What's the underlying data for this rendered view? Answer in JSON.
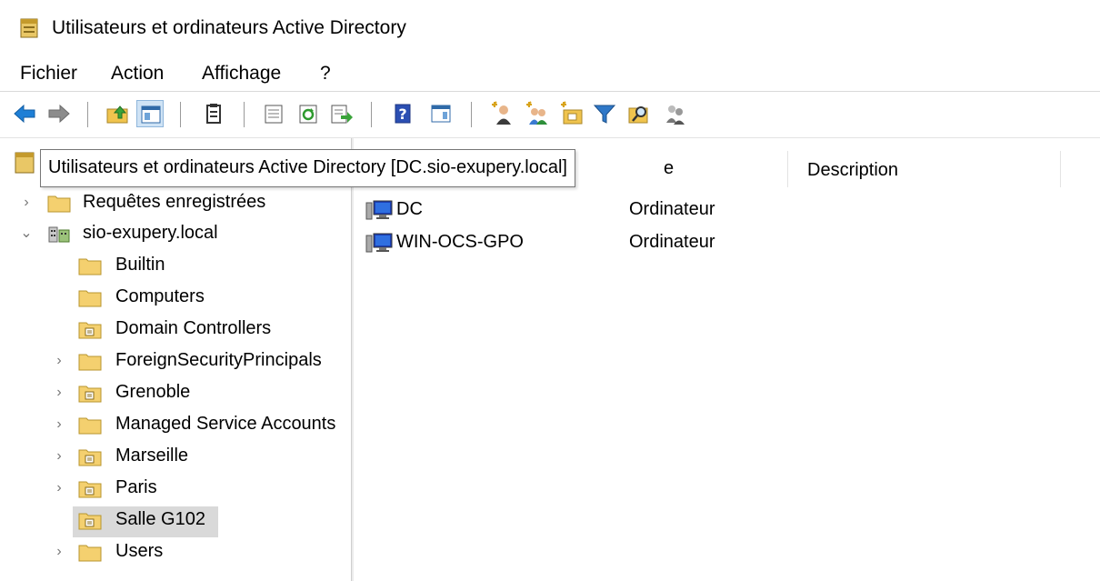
{
  "window": {
    "title": "Utilisateurs et ordinateurs Active Directory",
    "app_icon": "ad-snapin-icon"
  },
  "menubar": {
    "items": [
      {
        "label": "Fichier"
      },
      {
        "label": "Action"
      },
      {
        "label": "Affichage"
      },
      {
        "label": "?"
      }
    ]
  },
  "toolbar": {
    "buttons": [
      "back-arrow-icon",
      "forward-arrow-icon",
      "up-folder-icon",
      "show-hide-console-tree-icon",
      "clipboard-icon",
      "properties-icon",
      "refresh-icon",
      "export-list-icon",
      "help-icon",
      "show-action-pane-icon",
      "new-user-icon",
      "new-group-icon",
      "new-ou-icon",
      "filter-icon",
      "find-icon",
      "add-to-group-icon"
    ]
  },
  "tooltip": {
    "text": "Utilisateurs et ordinateurs Active Directory [DC.sio-exupery.local]"
  },
  "tree": {
    "items": [
      {
        "label": "Requêtes enregistrées",
        "icon": "folder-icon",
        "expander": "collapsed"
      },
      {
        "label": "sio-exupery.local",
        "icon": "domain-icon",
        "expander": "expanded"
      },
      {
        "label": "Builtin",
        "icon": "folder-icon",
        "expander": "none"
      },
      {
        "label": "Computers",
        "icon": "folder-icon",
        "expander": "none"
      },
      {
        "label": "Domain Controllers",
        "icon": "ou-icon",
        "expander": "none"
      },
      {
        "label": "ForeignSecurityPrincipals",
        "icon": "folder-icon",
        "expander": "collapsed"
      },
      {
        "label": "Grenoble",
        "icon": "ou-icon",
        "expander": "collapsed"
      },
      {
        "label": "Managed Service Accounts",
        "icon": "folder-icon",
        "expander": "collapsed"
      },
      {
        "label": "Marseille",
        "icon": "ou-icon",
        "expander": "collapsed"
      },
      {
        "label": "Paris",
        "icon": "ou-icon",
        "expander": "collapsed"
      },
      {
        "label": "Salle G102",
        "icon": "ou-icon",
        "expander": "none",
        "selected": true
      },
      {
        "label": "Users",
        "icon": "folder-icon",
        "expander": "collapsed"
      }
    ]
  },
  "list": {
    "columns": [
      {
        "label": "e"
      },
      {
        "label": "Description"
      }
    ],
    "rows": [
      {
        "name": "DC",
        "type": "Ordinateur",
        "icon": "computer-icon"
      },
      {
        "name": "WIN-OCS-GPO",
        "type": "Ordinateur",
        "icon": "computer-icon"
      }
    ]
  },
  "colors": {
    "selection": "#d9d9d9",
    "folder": "#f4d06f",
    "toolbar_active": "#cfe3f5"
  }
}
